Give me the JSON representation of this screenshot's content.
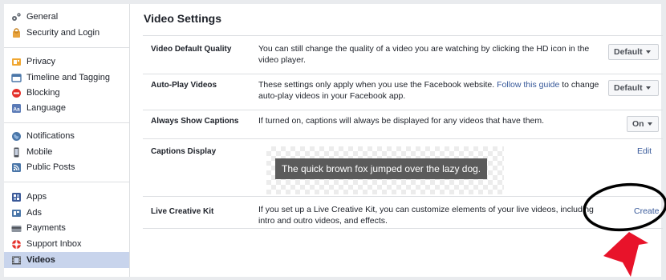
{
  "sidebar": {
    "items": [
      {
        "label": "General"
      },
      {
        "label": "Security and Login"
      },
      {
        "label": "Privacy"
      },
      {
        "label": "Timeline and Tagging"
      },
      {
        "label": "Blocking"
      },
      {
        "label": "Language"
      },
      {
        "label": "Notifications"
      },
      {
        "label": "Mobile"
      },
      {
        "label": "Public Posts"
      },
      {
        "label": "Apps"
      },
      {
        "label": "Ads"
      },
      {
        "label": "Payments"
      },
      {
        "label": "Support Inbox"
      },
      {
        "label": "Videos"
      }
    ],
    "active": "Videos"
  },
  "main": {
    "title": "Video Settings",
    "rows": [
      {
        "label": "Video Default Quality",
        "desc": "You can still change the quality of a video you are watching by clicking the HD icon in the video player.",
        "control": "Default"
      },
      {
        "label": "Auto-Play Videos",
        "desc_before": "These settings only apply when you use the Facebook website.",
        "desc_link": "Follow this guide",
        "desc_after": "to change auto-play videos in your Facebook app.",
        "control": "Default"
      },
      {
        "label": "Always Show Captions",
        "desc": "If turned on, captions will always be displayed for any videos that have them.",
        "control": "On"
      },
      {
        "label": "Captions Display",
        "preview_text": "The quick brown fox jumped over the lazy dog.",
        "control": "Edit"
      },
      {
        "label": "Live Creative Kit",
        "desc": "If you set up a Live Creative Kit, you can customize elements of your live videos, including intro and outro videos, and effects.",
        "control": "Create"
      }
    ]
  },
  "colors": {
    "link": "#365899",
    "active_bg": "#c8d4ec",
    "annotation_arrow": "#e8132a"
  }
}
